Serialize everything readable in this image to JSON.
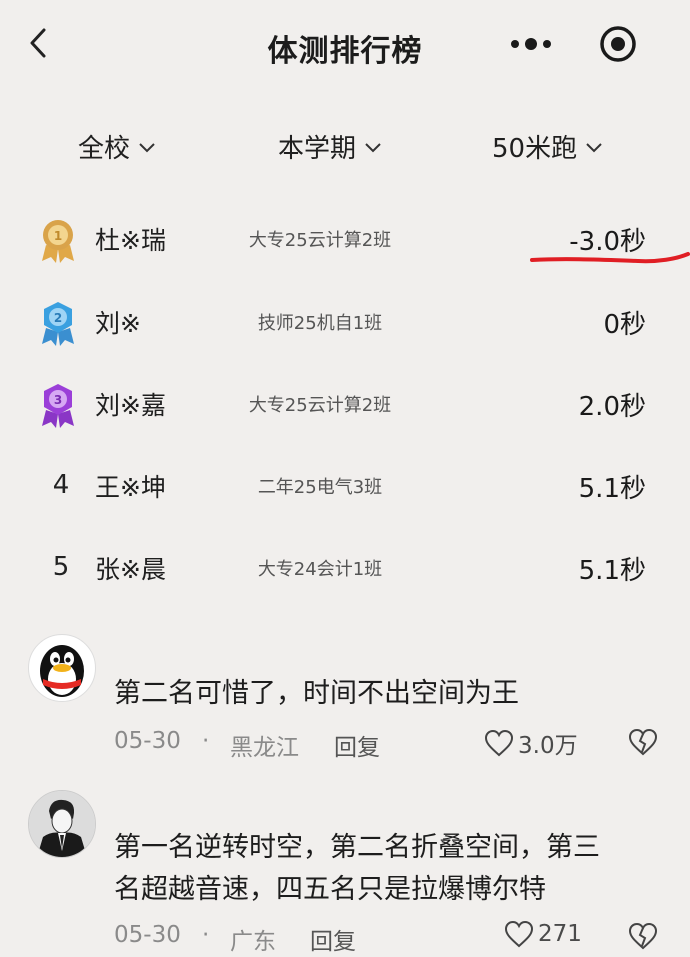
{
  "header": {
    "title": "体测排行榜"
  },
  "filters": {
    "scope": "全校",
    "period": "本学期",
    "event": "50米跑"
  },
  "ranking": [
    {
      "rank": "1",
      "medal": "gold-medal-icon",
      "name": "杜※瑞",
      "class": "大专25云计算2班",
      "time": "-3.0秒"
    },
    {
      "rank": "2",
      "medal": "blue-medal-icon",
      "name": "刘※",
      "class": "技师25机自1班",
      "time": "0秒"
    },
    {
      "rank": "3",
      "medal": "purple-medal-icon",
      "name": "刘※嘉",
      "class": "大专25云计算2班",
      "time": "2.0秒"
    },
    {
      "rank": "4",
      "name": "王※坤",
      "class": "二年25电气3班",
      "time": "5.1秒"
    },
    {
      "rank": "5",
      "name": "张※晨",
      "class": "大专24会计1班",
      "time": "5.1秒"
    }
  ],
  "colors": {
    "background": "#f1efed",
    "gold": "#d9a34a",
    "blue": "#3aa0e0",
    "purple": "#9b3fd8",
    "annotation_red": "#e01e24"
  },
  "comments": [
    {
      "avatar": "penguin-avatar",
      "lines": [
        "第二名可惜了，时间不出空间为王"
      ],
      "date": "05-30",
      "location": "黑龙江",
      "reply_label": "回复",
      "likes": "3.0万"
    },
    {
      "avatar": "sketch-man-avatar",
      "lines": [
        "第一名逆转时空，第二名折叠空间，第三",
        "名超越音速，四五名只是拉爆博尔特"
      ],
      "date": "05-30",
      "location": "广东",
      "reply_label": "回复",
      "likes": "271"
    }
  ],
  "meta_separator": "·"
}
